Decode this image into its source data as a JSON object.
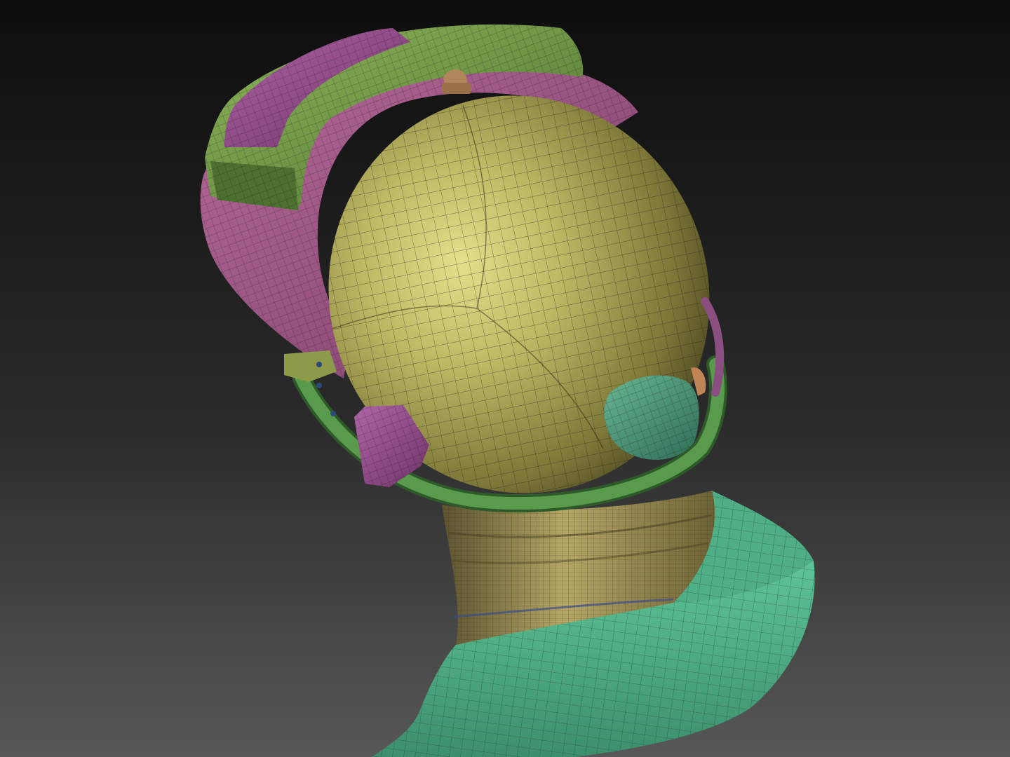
{
  "scene": {
    "subject": "helmet-wireframe-model",
    "colors": {
      "background_top": "#111111",
      "background_bottom": "#505050",
      "dome": "#b8b35f",
      "dome_highlight": "#dedd8a",
      "dome_shadow": "#4a4622",
      "strap_green": "#7aa04a",
      "strap_green_dark": "#3e5a26",
      "pad_magenta": "#9a4f92",
      "pad_magenta_dark": "#5c2a58",
      "rim_green": "#4f8a44",
      "ear_cup_teal": "#4f9f7f",
      "neck_cloth": "#aa9d5a",
      "neck_cloth_dark": "#5e5530",
      "collar_teal": "#55b88e",
      "collar_teal_dark": "#2e6e55",
      "wire": "#1c1c10"
    }
  }
}
